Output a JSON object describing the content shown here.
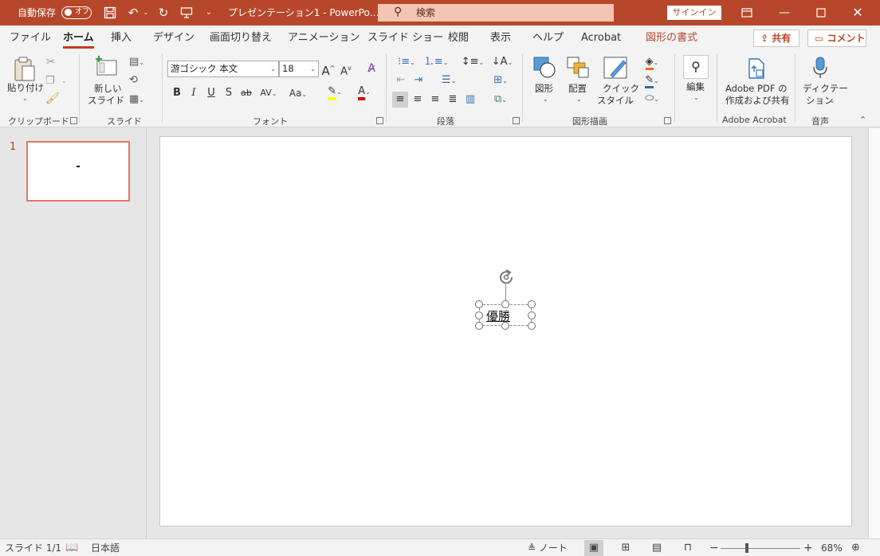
{
  "titlebar": {
    "autosave_label": "自動保存",
    "autosave_state": "オフ",
    "doc_title": "プレゼンテーション1 - PowerPo…",
    "search_placeholder": "検索",
    "signin_label": "サインイン"
  },
  "tabs": [
    {
      "label": "ファイル"
    },
    {
      "label": "ホーム"
    },
    {
      "label": "挿入"
    },
    {
      "label": "デザイン"
    },
    {
      "label": "画面切り替え"
    },
    {
      "label": "アニメーション"
    },
    {
      "label": "スライド ショー"
    },
    {
      "label": "校閲"
    },
    {
      "label": "表示"
    },
    {
      "label": "ヘルプ"
    },
    {
      "label": "Acrobat"
    },
    {
      "label": "図形の書式"
    }
  ],
  "share_label": "共有",
  "comment_label": "コメント",
  "ribbon": {
    "clipboard": {
      "paste_label": "貼り付け",
      "group_label": "クリップボード"
    },
    "slides": {
      "new_slide_line1": "新しい",
      "new_slide_line2": "スライド",
      "group_label": "スライド"
    },
    "font": {
      "font_name": "游ゴシック 本文",
      "font_size": "18",
      "group_label": "フォント"
    },
    "paragraph": {
      "group_label": "段落"
    },
    "drawing": {
      "shapes_label": "図形",
      "arrange_label": "配置",
      "quick_styles_line1": "クイック",
      "quick_styles_line2": "スタイル",
      "group_label": "図形描画"
    },
    "editing": {
      "label": "編集"
    },
    "acrobat": {
      "pdf_line1": "Adobe PDF の",
      "pdf_line2": "作成および共有",
      "group_label": "Adobe Acrobat"
    },
    "voice": {
      "dictate_line1": "ディクテー",
      "dictate_line2": "ション",
      "group_label": "音声"
    }
  },
  "thumbnail": {
    "number": "1",
    "text": "-"
  },
  "slide": {
    "textbox_text": "優勝"
  },
  "status": {
    "slide_count": "スライド 1/1",
    "language": "日本語",
    "notes_label": "ノート",
    "zoom": "68%",
    "zoom_percent": 68
  },
  "colors": {
    "accent": "#b7472a",
    "tab_underline": "#c43e1c",
    "thumb_border": "#e07a5f"
  }
}
